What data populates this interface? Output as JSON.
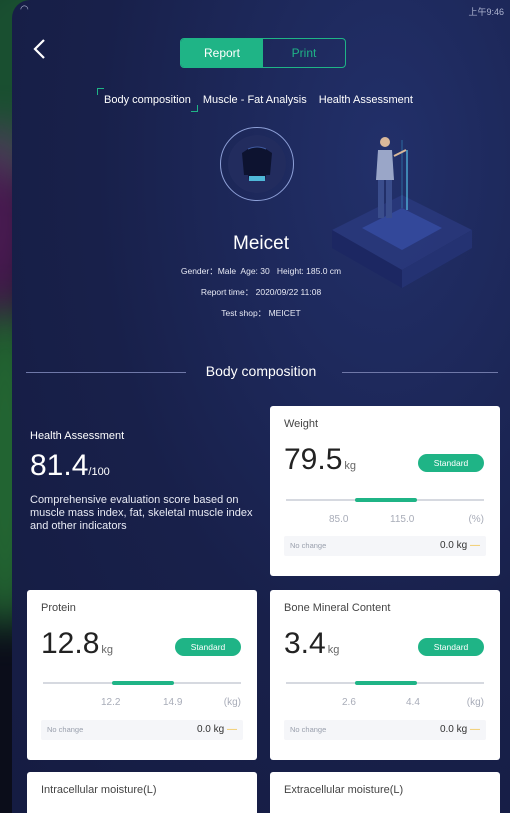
{
  "status": {
    "right_text": "上午9:46"
  },
  "toggle": {
    "report": "Report",
    "print": "Print"
  },
  "tabs": [
    "Body composition",
    "Muscle - Fat Analysis",
    "Health Assessment"
  ],
  "profile": {
    "name": "Meicet",
    "gender_label": "Gender：",
    "gender": "Male",
    "age_label": "Age:",
    "age": "30",
    "height_label": "Height:",
    "height": "185.0 cm",
    "report_time_label": "Report time：",
    "report_time": "2020/09/22 11:08",
    "shop_label": "Test shop：",
    "shop": "MEICET"
  },
  "section_title": "Body composition",
  "health": {
    "label": "Health Assessment",
    "score": "81.4",
    "max": "/100",
    "description": "Comprehensive evaluation score based on muscle mass index, fat, skeletal muscle index and other indicators"
  },
  "cards": {
    "weight": {
      "title": "Weight",
      "value": "79.5",
      "unit": "kg",
      "badge": "Standard",
      "low": "85.0",
      "high": "115.0",
      "scale_unit": "(%)",
      "change_label": "No change",
      "change_value": "0.0 kg",
      "fill_start": 0.35,
      "fill_end": 0.66
    },
    "protein": {
      "title": "Protein",
      "value": "12.8",
      "unit": "kg",
      "badge": "Standard",
      "low": "12.2",
      "high": "14.9",
      "scale_unit": "(kg)",
      "change_label": "No change",
      "change_value": "0.0 kg",
      "fill_start": 0.35,
      "fill_end": 0.66
    },
    "bone": {
      "title": "Bone Mineral Content",
      "value": "3.4",
      "unit": "kg",
      "badge": "Standard",
      "low": "2.6",
      "high": "4.4",
      "scale_unit": "(kg)",
      "change_label": "No change",
      "change_value": "0.0 kg",
      "fill_start": 0.35,
      "fill_end": 0.66
    },
    "intracellular": {
      "title": "Intracellular moisture(L)"
    },
    "extracellular": {
      "title": "Extracellular moisture(L)"
    }
  },
  "colors": {
    "accent": "#1fb486",
    "background": "#18204a",
    "card": "#ffffff"
  }
}
